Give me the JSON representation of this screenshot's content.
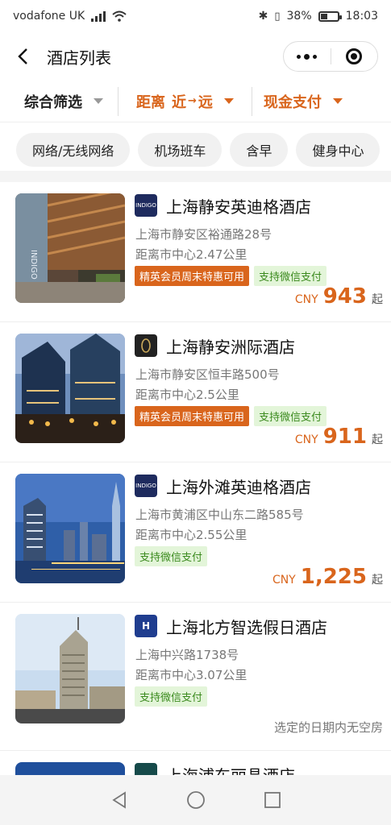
{
  "status_bar": {
    "carrier": "vodafone UK",
    "battery": "38%",
    "time": "18:03",
    "battery_level": 0.38
  },
  "header": {
    "title": "酒店列表"
  },
  "filters": {
    "composite": "综合筛选",
    "distance_label": "距离",
    "distance_near": "近",
    "distance_arrow": "→",
    "distance_far": "远",
    "payment": "现金支付"
  },
  "tags": [
    "网络/无线网络",
    "机场班车",
    "含早",
    "健身中心"
  ],
  "colors": {
    "accent": "#d9651c",
    "green_badge_bg": "#e3f5d9",
    "green_badge_text": "#3b8a1e"
  },
  "hotels": [
    {
      "name": "上海静安英迪格酒店",
      "address": "上海市静安区裕通路28号",
      "distance": "距离市中心2.47公里",
      "badge_member": "精英会员周末特惠可用",
      "badge_wechat": "支持微信支付",
      "currency": "CNY",
      "price": "943",
      "suffix": "起",
      "logo": "hotel-indigo-logo"
    },
    {
      "name": "上海静安洲际酒店",
      "address": "上海市静安区恒丰路500号",
      "distance": "距离市中心2.5公里",
      "badge_member": "精英会员周末特惠可用",
      "badge_wechat": "支持微信支付",
      "currency": "CNY",
      "price": "911",
      "suffix": "起",
      "logo": "intercontinental-logo"
    },
    {
      "name": "上海外滩英迪格酒店",
      "address": "上海市黄浦区中山东二路585号",
      "distance": "距离市中心2.55公里",
      "badge_wechat": "支持微信支付",
      "currency": "CNY",
      "price": "1,225",
      "suffix": "起",
      "logo": "hotel-indigo-logo"
    },
    {
      "name": "上海北方智选假日酒店",
      "address": "上海中兴路1738号",
      "distance": "距离市中心3.07公里",
      "badge_wechat": "支持微信支付",
      "status": "选定的日期内无空房",
      "logo": "holiday-inn-express-logo"
    },
    {
      "name": "上海浦东丽晶酒店"
    }
  ]
}
